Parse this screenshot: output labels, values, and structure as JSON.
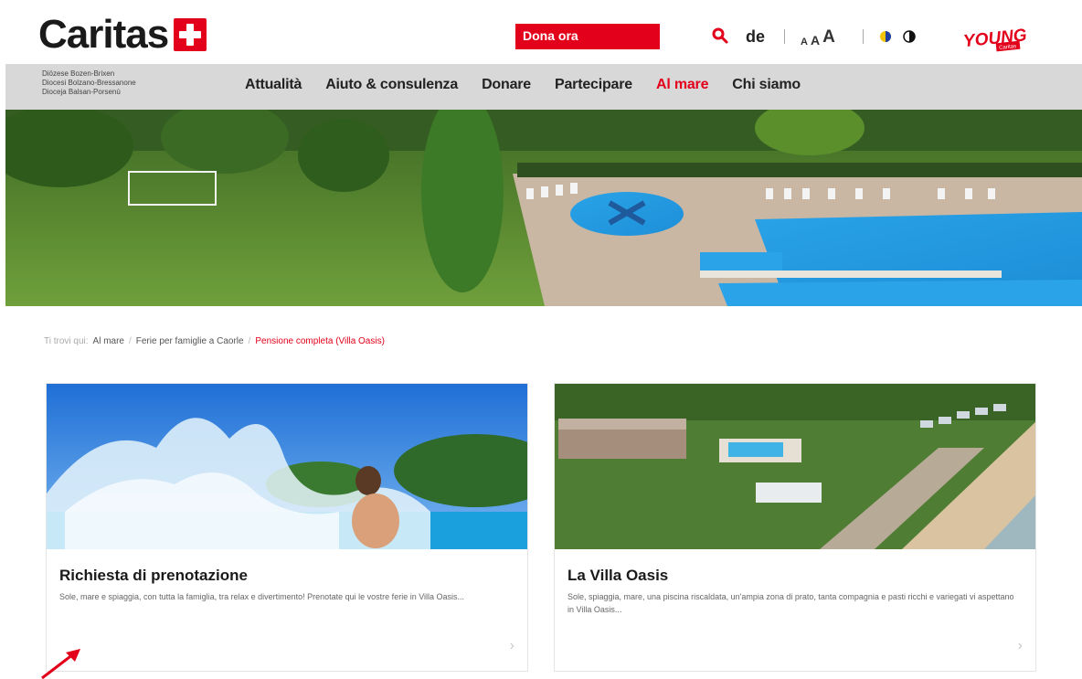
{
  "header": {
    "logo_text": "Caritas",
    "donate_label": "Dona ora",
    "language": "de",
    "font_sizes": [
      "A",
      "A",
      "A"
    ],
    "young_logo_text": "YOUNG",
    "young_logo_sub": "Caritas"
  },
  "nav": {
    "diocese_lines": [
      "Diözese Bozen-Brixen",
      "Diocesi Bolzano-Bressanone",
      "Dioceja Balsan-Porsenù"
    ],
    "items": [
      {
        "label": "Attualità",
        "active": false
      },
      {
        "label": "Aiuto & consulenza",
        "active": false
      },
      {
        "label": "Donare",
        "active": false
      },
      {
        "label": "Partecipare",
        "active": false
      },
      {
        "label": "Al mare",
        "active": true
      },
      {
        "label": "Chi siamo",
        "active": false
      }
    ]
  },
  "breadcrumb": {
    "items": [
      "Ti trovi qui:",
      "Al mare",
      "Ferie per famiglie a Caorle",
      "Pensione completa (Villa Oasis)"
    ],
    "separator": "/"
  },
  "cards": [
    {
      "title": "Richiesta di prenotazione",
      "text": "Sole, mare e spiaggia, con tutta la famiglia, tra relax e divertimento! Prenotate qui le vostre ferie in Villa Oasis..."
    },
    {
      "title": "La Villa Oasis",
      "text": "Sole, spiaggia, mare, una piscina riscaldata, un'ampia zona di prato, tanta compagnia e pasti ricchi e variegati vi aspettano in Villa Oasis..."
    }
  ],
  "colors": {
    "brand_red": "#e2001a",
    "nav_bg": "#d8d8d8"
  },
  "icons": [
    "search-icon",
    "contrast-color-icon",
    "contrast-bw-icon",
    "caritas-cross-icon",
    "chevron-right-icon",
    "cursor-arrow-icon"
  ]
}
